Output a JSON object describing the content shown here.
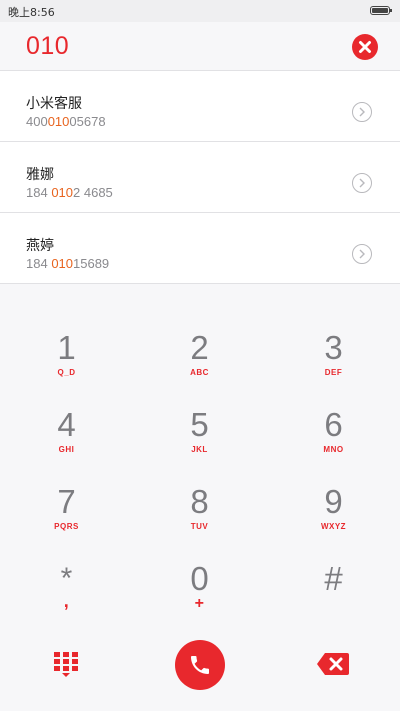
{
  "status_bar": {
    "time": "晚上8:56"
  },
  "dialer": {
    "input_value": "010"
  },
  "contacts": [
    {
      "name": "小米客服",
      "number_pre": "400",
      "number_hl": "010",
      "number_post": "05678"
    },
    {
      "name": "雅娜",
      "number_pre": "184 ",
      "number_hl": "010",
      "number_post": "2 4685"
    },
    {
      "name": "燕婷",
      "number_pre": "184 ",
      "number_hl": "010",
      "number_post": "15689"
    }
  ],
  "keys": [
    {
      "digit": "1",
      "letters": "Q_D"
    },
    {
      "digit": "2",
      "letters": "ABC"
    },
    {
      "digit": "3",
      "letters": "DEF"
    },
    {
      "digit": "4",
      "letters": "GHI"
    },
    {
      "digit": "5",
      "letters": "JKL"
    },
    {
      "digit": "6",
      "letters": "MNO"
    },
    {
      "digit": "7",
      "letters": "PQRS"
    },
    {
      "digit": "8",
      "letters": "TUV"
    },
    {
      "digit": "9",
      "letters": "WXYZ"
    },
    {
      "digit": "*",
      "letters": ","
    },
    {
      "digit": "0",
      "letters": "+"
    },
    {
      "digit": "#",
      "letters": ""
    }
  ],
  "icons": {
    "clear": "clear-circle-x-icon",
    "detail": "chevron-right-circle-icon",
    "keypad_toggle": "dialpad-grid-icon",
    "call": "phone-handset-icon",
    "backspace": "backspace-x-icon"
  },
  "colors": {
    "accent": "#e8282d",
    "highlight": "#e8641f",
    "text_gray": "#8a8a8e"
  }
}
